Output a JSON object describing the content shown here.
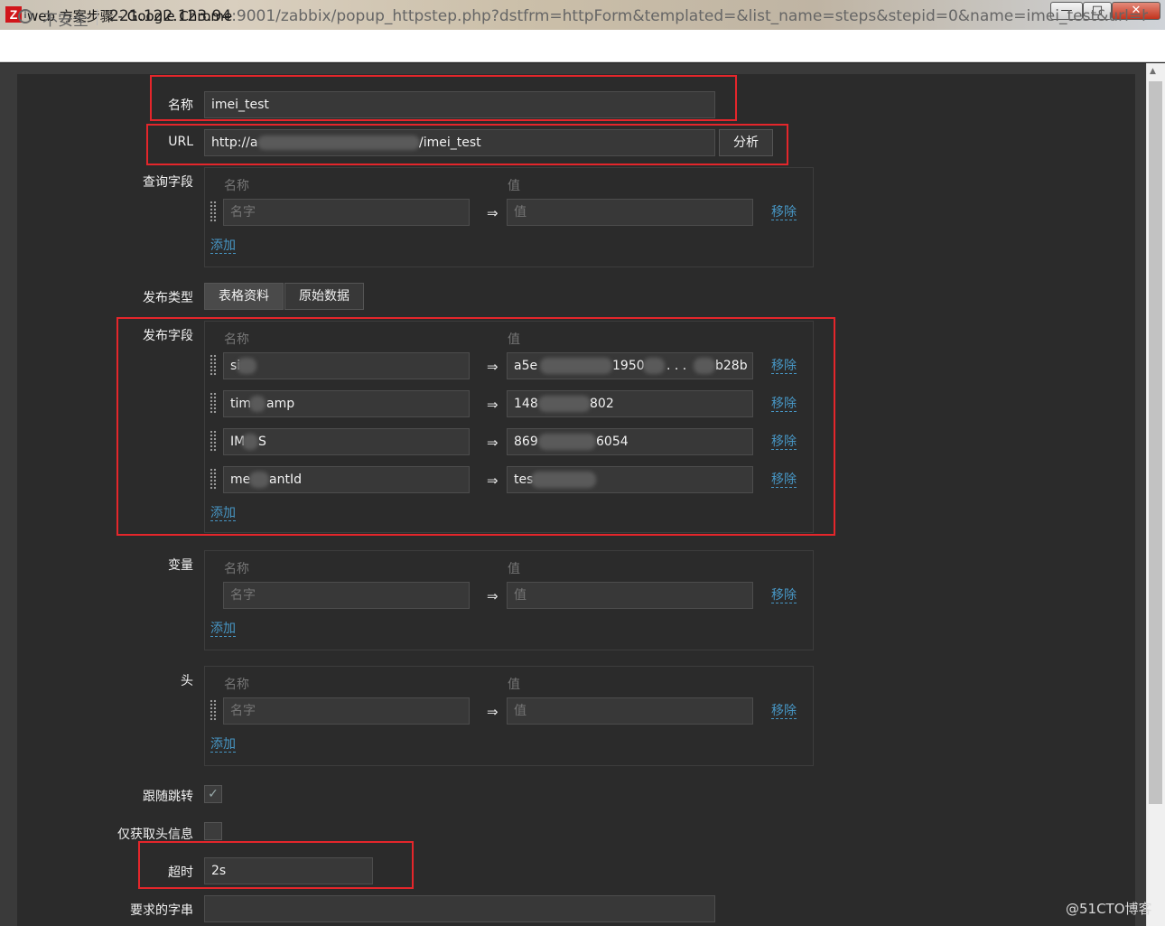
{
  "window": {
    "title": "web 方案步骤 - Google Chrome",
    "app_icon_letter": "Z",
    "minimize": "—",
    "maximize": "□",
    "close": "✕"
  },
  "address_bar": {
    "security_label": "不安全",
    "url_host": "221.122.123.94",
    "url_rest": ":9001/zabbix/popup_httpstep.php?dstfrm=httpForm&templated=&list_name=steps&stepid=0&name=imei_test&url=h..."
  },
  "form": {
    "name_label": "名称",
    "name_value": "imei_test",
    "url_label": "URL",
    "url_value_start": "http://a",
    "url_value_end": "/imei_test",
    "parse_button": "分析",
    "query_fields": {
      "label": "查询字段",
      "col_name": "名称",
      "col_value": "值",
      "rows": [
        {
          "name_placeholder": "名字",
          "value_placeholder": "值",
          "remove": "移除"
        }
      ],
      "add": "添加"
    },
    "post_type": {
      "label": "发布类型",
      "options": [
        "表格资料",
        "原始数据"
      ]
    },
    "post_fields": {
      "label": "发布字段",
      "col_name": "名称",
      "col_value": "值",
      "rows": [
        {
          "name": "si",
          "value": "a5e",
          "value_mid": "1950",
          "value_dots": ". . .",
          "value_end": "b28b",
          "remove": "移除"
        },
        {
          "name": "tim",
          "name_end": "amp",
          "value": "148",
          "value_end": "802",
          "remove": "移除"
        },
        {
          "name": "IM",
          "name_end": "S",
          "value": "869",
          "value_end": "6054",
          "remove": "移除"
        },
        {
          "name": "me",
          "name_end": "antId",
          "value": "tes",
          "value_end": "",
          "remove": "移除"
        }
      ],
      "add": "添加"
    },
    "variables": {
      "label": "变量",
      "col_name": "名称",
      "col_value": "值",
      "rows": [
        {
          "name_placeholder": "名字",
          "value_placeholder": "值",
          "remove": "移除"
        }
      ],
      "add": "添加"
    },
    "headers": {
      "label": "头",
      "col_name": "名称",
      "col_value": "值",
      "rows": [
        {
          "name_placeholder": "名字",
          "value_placeholder": "值",
          "remove": "移除"
        }
      ],
      "add": "添加"
    },
    "follow_redirects": {
      "label": "跟随跳转",
      "checked": true,
      "check_glyph": "✓"
    },
    "retrieve_headers_only": {
      "label": "仅获取头信息",
      "checked": false
    },
    "timeout": {
      "label": "超时",
      "value": "2s"
    },
    "required_string": {
      "label": "要求的字串",
      "value": ""
    }
  },
  "watermark": "@51CTO博客",
  "colors": {
    "highlight": "#e4262b",
    "link": "#4796c4",
    "background": "#2b2b2b"
  },
  "icons": {
    "info": "i",
    "arrow": "⇒",
    "scroll_up": "▲"
  }
}
